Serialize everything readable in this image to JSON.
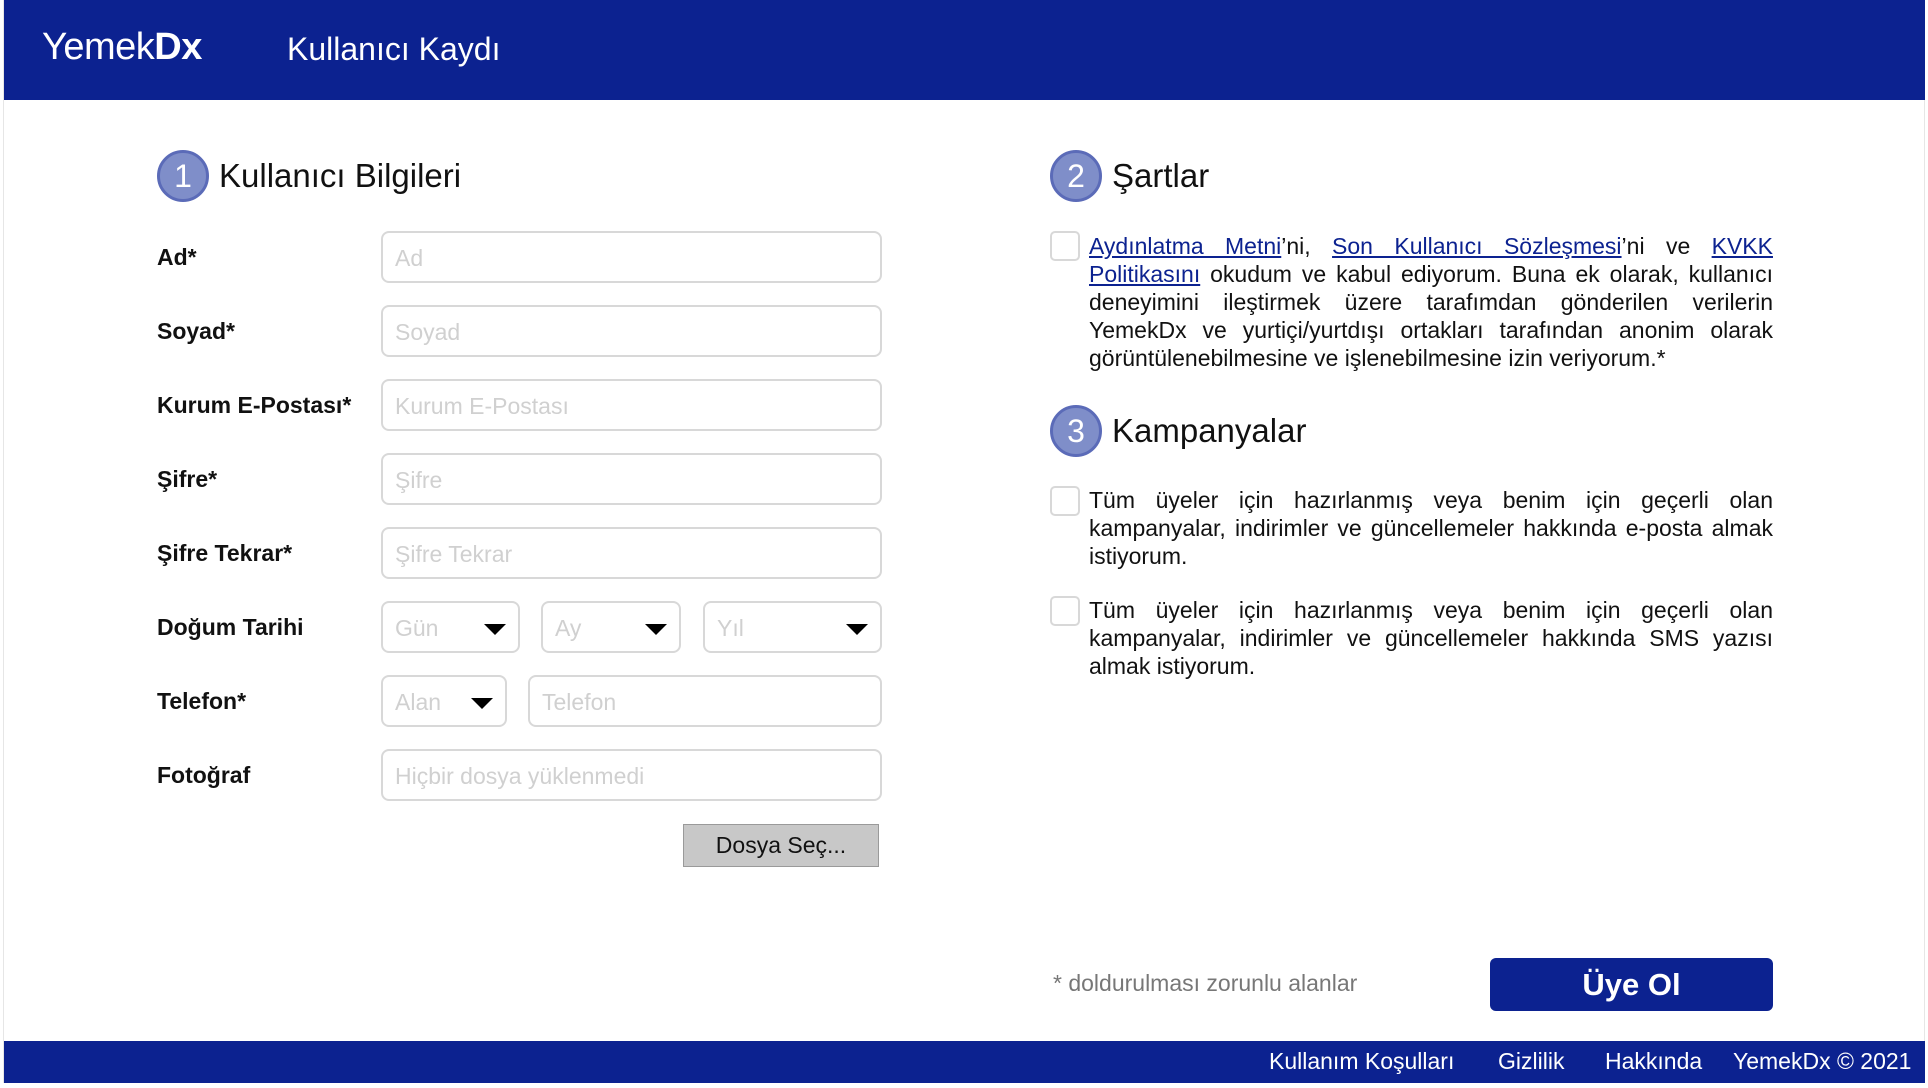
{
  "header": {
    "logo_regular": "Yemek",
    "logo_bold": "Dx",
    "title": "Kullanıcı Kaydı"
  },
  "section1": {
    "number": "1",
    "title": "Kullanıcı Bilgileri"
  },
  "form": {
    "ad": {
      "label": "Ad*",
      "placeholder": "Ad"
    },
    "soyad": {
      "label": "Soyad*",
      "placeholder": "Soyad"
    },
    "email": {
      "label": "Kurum E-Postası*",
      "placeholder": "Kurum E-Postası"
    },
    "sifre": {
      "label": "Şifre*",
      "placeholder": "Şifre"
    },
    "sifre_tekrar": {
      "label": "Şifre Tekrar*",
      "placeholder": "Şifre Tekrar"
    },
    "dogum": {
      "label": "Doğum Tarihi",
      "gun": "Gün",
      "ay": "Ay",
      "yil": "Yıl"
    },
    "telefon": {
      "label": "Telefon*",
      "alan": "Alan",
      "placeholder": "Telefon"
    },
    "foto": {
      "label": "Fotoğraf",
      "placeholder": "Hiçbir dosya yüklenmedi",
      "button": "Dosya Seç..."
    }
  },
  "section2": {
    "number": "2",
    "title": "Şartlar",
    "link1": "Aydınlatma Metni",
    "text1": "’ni, ",
    "link2": "Son Kullanıcı Sözleşmesi",
    "text2": "’ni ve ",
    "link3": "KVKK Politikasını",
    "text3": " okudum ve kabul ediyorum. Buna ek olarak, kullanıcı deneyimini ileştirmek üzere tarafımdan gönderilen verilerin YemekDx ve yurtiçi/yurtdışı ortakları tarafından anonim olarak görüntülenebilmesine ve işlenebilmesine izin veriyorum.*"
  },
  "section3": {
    "number": "3",
    "title": "Kampanyalar",
    "email_consent": "Tüm üyeler için hazırlanmış veya benim için geçerli olan kampanyalar, indirimler ve güncellemeler hakkında e-posta almak istiyorum.",
    "sms_consent": "Tüm üyeler için hazırlanmış veya benim için geçerli olan kampanyalar, indirimler ve güncellemeler hakkında SMS yazısı almak istiyorum."
  },
  "required_note": "* doldurulması zorunlu alanlar",
  "submit_label": "Üye Ol",
  "footer": {
    "terms": "Kullanım Koşulları",
    "privacy": "Gizlilik",
    "about": "Hakkında",
    "copyright": "YemekDx © 2021"
  },
  "colors": {
    "brand": "#0c2290",
    "step_circle": "#7f8ec9",
    "file_button": "#c8c8c8"
  }
}
